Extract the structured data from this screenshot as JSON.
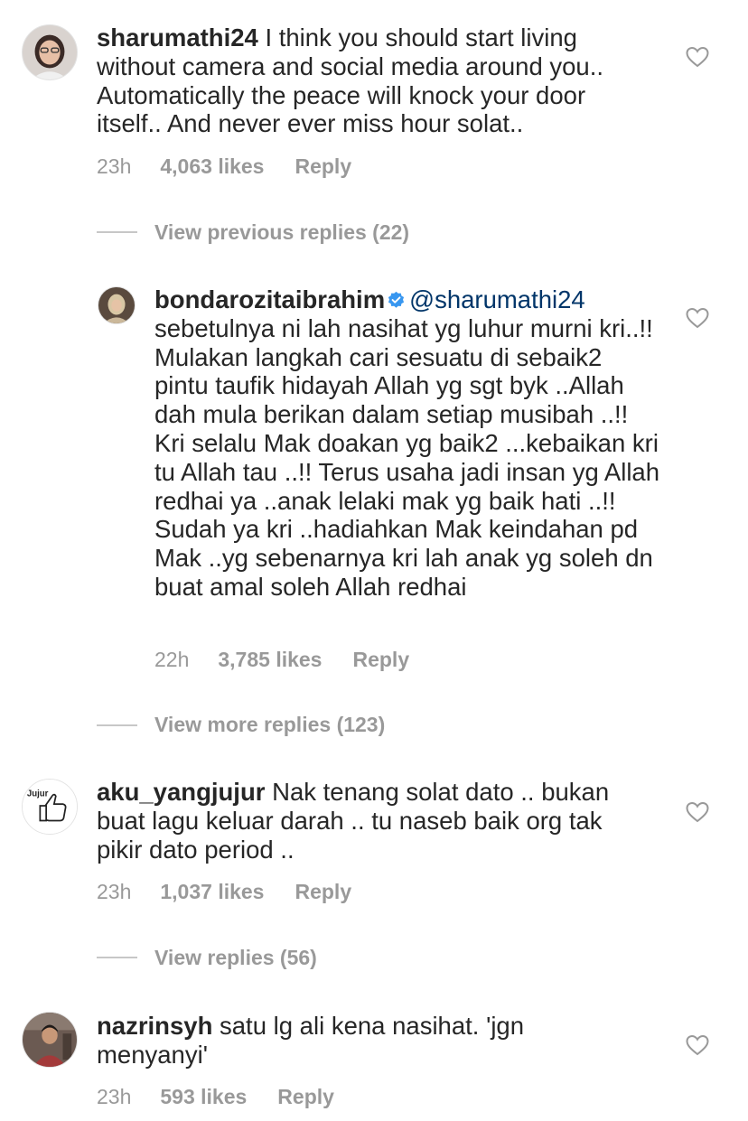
{
  "comments": [
    {
      "username": "sharumathi24",
      "text": " I think you should start living without camera and social media around you.. Automatically the peace will knock your door itself.. And never ever miss hour solat..",
      "time": "23h",
      "likes": "4,063 likes",
      "reply": "Reply",
      "avatar_icon": "profile-photo"
    },
    {
      "username": "bondarozitaibrahim",
      "verified": true,
      "mention": "@sharumathi24",
      "text": "sebetulnya ni lah nasihat yg luhur murni kri..!! Mulakan langkah cari sesuatu di sebaik2 pintu taufik hidayah Allah yg sgt byk ..Allah dah mula berikan dalam setiap musibah ..!! Kri selalu Mak doakan yg baik2 ...kebaikan kri tu Allah tau ..!! Terus usaha jadi insan yg Allah redhai ya ..anak lelaki mak yg baik hati ..!! Sudah ya kri ..hadiahkan Mak keindahan pd Mak ..yg sebenarnya kri lah anak yg soleh dn buat amal soleh Allah redhai",
      "time": "22h",
      "likes": "3,785 likes",
      "reply": "Reply",
      "avatar_icon": "profile-photo"
    },
    {
      "username": "aku_yangjujur",
      "text": " Nak tenang solat dato .. bukan buat lagu keluar darah .. tu naseb baik org tak pikir dato period ..",
      "time": "23h",
      "likes": "1,037 likes",
      "reply": "Reply",
      "avatar_icon": "thumbs-up-logo",
      "avatar_text": "Jujur"
    },
    {
      "username": "nazrinsyh",
      "text": " satu lg ali kena nasihat. 'jgn menyanyi'",
      "time": "23h",
      "likes": "593 likes",
      "reply": "Reply",
      "avatar_icon": "profile-photo"
    }
  ],
  "threads": {
    "previous": "View previous replies (22)",
    "more": "View more replies (123)",
    "replies": "View replies (56)"
  },
  "icons": {
    "like": "heart-outline-icon",
    "verified": "verified-badge-icon"
  },
  "colors": {
    "text": "#262626",
    "meta": "#999999",
    "mention": "#003569",
    "verified": "#3897f0",
    "divider": "#c7c7c7"
  }
}
